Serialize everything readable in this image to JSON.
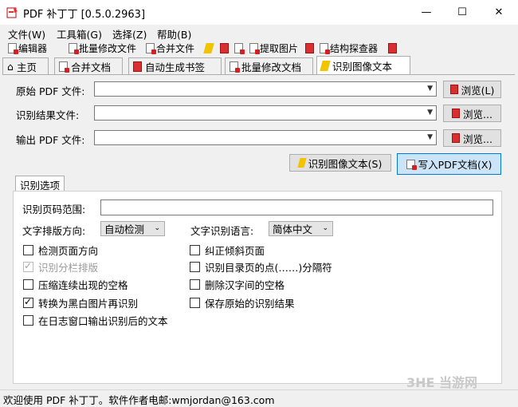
{
  "window": {
    "title": "PDF 补丁丁 [0.5.0.2963]",
    "minimize_glyph": "—",
    "maximize_glyph": "☐",
    "close_glyph": "✕"
  },
  "menu": [
    "文件(W)",
    "工具箱(G)",
    "选择(Z)",
    "帮助(B)"
  ],
  "toolbar": {
    "editor": "编辑器",
    "batch_edit": "批量修改文件",
    "merge": "合并文件",
    "extract_images": "提取图片",
    "structure_explorer": "结构探查器"
  },
  "tabs": [
    "主页",
    "合并文档",
    "自动生成书签",
    "批量修改文档",
    "识别图像文本"
  ],
  "form": {
    "source_label": "原始 PDF 文件:",
    "result_label": "识别结果文件:",
    "output_label": "输出 PDF 文件:",
    "browse_source": "浏览(L)",
    "browse_result": "浏览...",
    "browse_output": "浏览...",
    "ocr_button": "识别图像文本(S)",
    "write_pdf_button": "写入PDF文档(X)"
  },
  "options": {
    "group_title": "识别选项",
    "page_range_label": "识别页码范围:",
    "layout_label": "文字排版方向:",
    "layout_value": "自动检测",
    "language_label": "文字识别语言:",
    "language_value": "简体中文",
    "checkboxes_left": [
      {
        "label": "检测页面方向",
        "checked": false,
        "disabled": false
      },
      {
        "label": "识别分栏排版",
        "checked": true,
        "disabled": true
      },
      {
        "label": "压缩连续出现的空格",
        "checked": false,
        "disabled": false
      },
      {
        "label": "转换为黑白图片再识别",
        "checked": true,
        "disabled": false
      },
      {
        "label": "在日志窗口输出识别后的文本",
        "checked": false,
        "disabled": false
      }
    ],
    "checkboxes_right": [
      {
        "label": "纠正倾斜页面",
        "checked": false,
        "disabled": false
      },
      {
        "label": "识别目录页的点(……)分隔符",
        "checked": false,
        "disabled": false
      },
      {
        "label": "删除汉字间的空格",
        "checked": false,
        "disabled": false
      },
      {
        "label": "保存原始的识别结果",
        "checked": false,
        "disabled": false
      }
    ]
  },
  "status": "欢迎使用 PDF 补丁丁。软件作者电邮:wmjordan@163.com",
  "watermark": "3HE 当游网"
}
